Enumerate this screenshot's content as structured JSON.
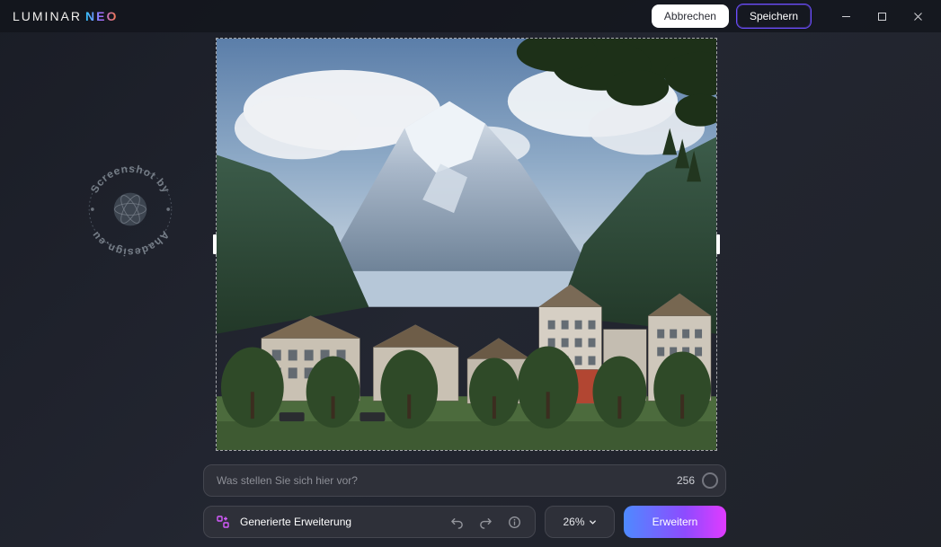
{
  "brand": {
    "luminar": "LUMINAR",
    "neo": "NEO"
  },
  "titlebar": {
    "cancel_label": "Abbrechen",
    "save_label": "Speichern"
  },
  "prompt": {
    "placeholder": "Was stellen Sie sich hier vor?",
    "char_limit": "256"
  },
  "toolbar": {
    "generated_label": "Generierte Erweiterung",
    "zoom_value": "26%",
    "expand_label": "Erweitern"
  },
  "watermark": {
    "outer_text_top": "Screenshot by",
    "outer_text_bottom": "Ahadesign.eu"
  },
  "icons": {
    "generate": "generate-icon",
    "undo": "undo-icon",
    "redo": "redo-icon",
    "info": "info-icon",
    "chevron": "chevron-down-icon",
    "minimize": "minimize-icon",
    "maximize": "maximize-icon",
    "close": "close-icon"
  }
}
